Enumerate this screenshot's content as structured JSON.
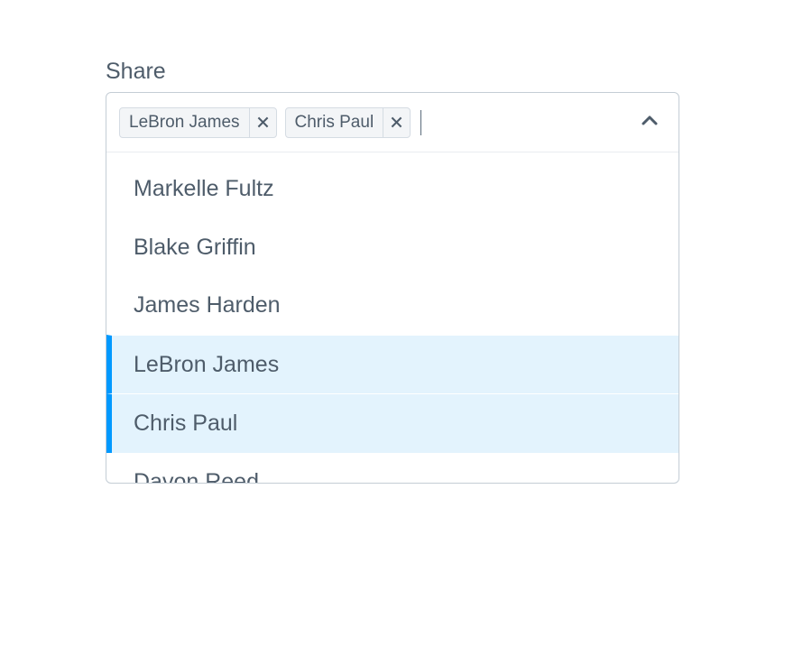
{
  "label": "Share",
  "selected": [
    {
      "name": "LeBron James"
    },
    {
      "name": "Chris Paul"
    }
  ],
  "options": [
    {
      "name": "Markelle Fultz",
      "selected": false
    },
    {
      "name": "Blake Griffin",
      "selected": false
    },
    {
      "name": "James Harden",
      "selected": false
    },
    {
      "name": "LeBron James",
      "selected": true
    },
    {
      "name": "Chris Paul",
      "selected": true
    },
    {
      "name": "Davon Reed",
      "selected": false
    }
  ]
}
